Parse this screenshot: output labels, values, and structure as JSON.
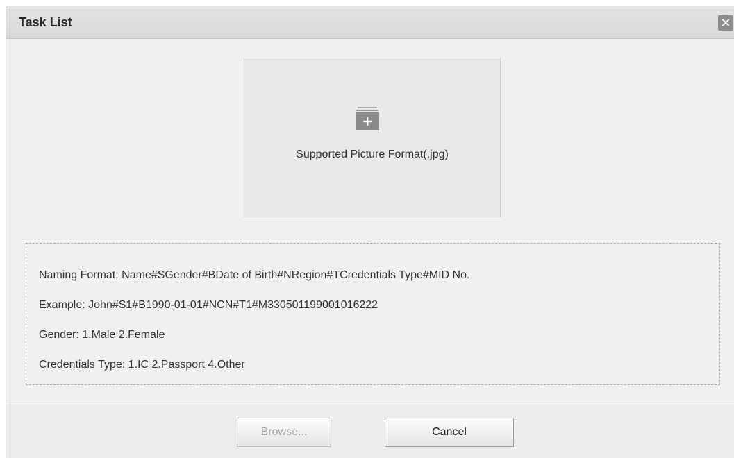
{
  "dialog": {
    "title": "Task List",
    "close_icon": "close-icon",
    "close_glyph": "✕"
  },
  "upload": {
    "icon": "folder-add-icon",
    "hint": "Supported Picture Format(.jpg)"
  },
  "info": {
    "lines": [
      "Naming Format:  Name#SGender#BDate of Birth#NRegion#TCredentials Type#MID No.",
      "Example:  John#S1#B1990-01-01#NCN#T1#M330501199001016222",
      "Gender:  1.Male 2.Female",
      "Credentials Type:  1.IC 2.Passport 4.Other"
    ]
  },
  "buttons": {
    "browse_label": "Browse...",
    "browse_state": "disabled",
    "cancel_label": "Cancel"
  },
  "colors": {
    "dialog_bg": "#f0f0f0",
    "titlebar_bg": "#dcdcdc",
    "upload_bg": "#e9e9e9",
    "icon_gray": "#8a8a8a"
  }
}
